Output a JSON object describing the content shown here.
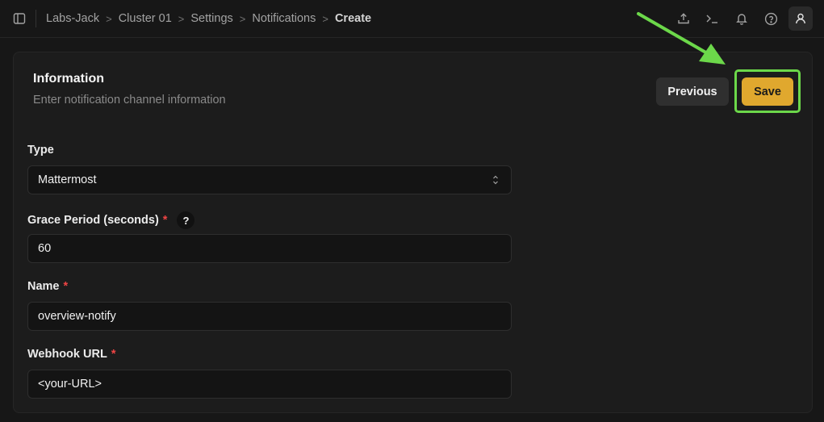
{
  "breadcrumb": [
    "Labs-Jack",
    "Cluster 01",
    "Settings",
    "Notifications",
    "Create"
  ],
  "header": {
    "icons": [
      "upload-icon",
      "terminal-icon",
      "bell-icon",
      "help-circle-icon",
      "user-icon"
    ]
  },
  "card": {
    "title": "Information",
    "subtitle": "Enter notification channel information",
    "previous_label": "Previous",
    "save_label": "Save"
  },
  "form": {
    "type": {
      "label": "Type",
      "value": "Mattermost"
    },
    "grace_period": {
      "label": "Grace Period (seconds)",
      "required": "*",
      "help": "?",
      "value": "60"
    },
    "name": {
      "label": "Name",
      "required": "*",
      "value": "overview-notify"
    },
    "webhook_url": {
      "label": "Webhook URL",
      "required": "*",
      "value": "<your-URL>"
    }
  },
  "colors": {
    "accent": "#e0a82e",
    "highlight": "#6cd84a",
    "required": "#ef4444",
    "background": "#171717"
  }
}
